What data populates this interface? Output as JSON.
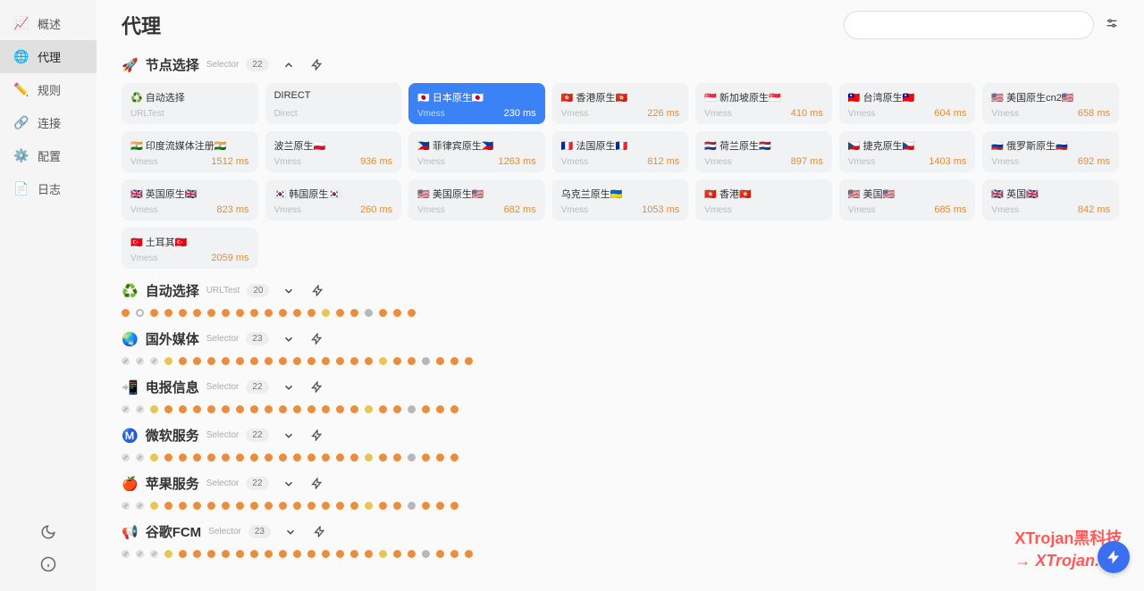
{
  "page_title": "代理",
  "sidebar": {
    "items": [
      {
        "icon": "📈",
        "label": "概述"
      },
      {
        "icon": "🌐",
        "label": "代理",
        "active": true
      },
      {
        "icon": "✏️",
        "label": "规则"
      },
      {
        "icon": "🔗",
        "label": "连接"
      },
      {
        "icon": "⚙️",
        "label": "配置"
      },
      {
        "icon": "📄",
        "label": "日志"
      }
    ]
  },
  "groups": [
    {
      "emoji": "🚀",
      "name": "节点选择",
      "type": "Selector",
      "count": "22",
      "expanded": true,
      "nodes": [
        {
          "title": "♻️ 自动选择",
          "proto": "URLTest",
          "latency": ""
        },
        {
          "title": "DIRECT",
          "proto": "Direct",
          "latency": ""
        },
        {
          "title": "🇯🇵 日本原生🇯🇵",
          "proto": "Vmess",
          "latency": "230 ms",
          "selected": true
        },
        {
          "title": "🇭🇰 香港原生🇭🇰",
          "proto": "Vmess",
          "latency": "226 ms"
        },
        {
          "title": "🇸🇬 新加坡原生🇸🇬",
          "proto": "Vmess",
          "latency": "410 ms"
        },
        {
          "title": "🇹🇼 台湾原生🇹🇼",
          "proto": "Vmess",
          "latency": "604 ms"
        },
        {
          "title": "🇺🇸 美国原生cn2🇺🇸",
          "proto": "Vmess",
          "latency": "658 ms"
        },
        {
          "title": "🇮🇳 印度流媒体注册🇮🇳",
          "proto": "Vmess",
          "latency": "1512 ms"
        },
        {
          "title": "波兰原生🇵🇱",
          "proto": "Vmess",
          "latency": "936 ms"
        },
        {
          "title": "🇵🇭 菲律宾原生🇵🇭",
          "proto": "Vmess",
          "latency": "1263 ms"
        },
        {
          "title": "🇫🇷 法国原生🇫🇷",
          "proto": "Vmess",
          "latency": "812 ms"
        },
        {
          "title": "🇳🇱 荷兰原生🇳🇱",
          "proto": "Vmess",
          "latency": "897 ms"
        },
        {
          "title": "🇨🇿 捷克原生🇨🇿",
          "proto": "Vmess",
          "latency": "1403 ms"
        },
        {
          "title": "🇷🇺 俄罗斯原生🇷🇺",
          "proto": "Vmess",
          "latency": "692 ms"
        },
        {
          "title": "🇬🇧 英国原生🇬🇧",
          "proto": "Vmess",
          "latency": "823 ms"
        },
        {
          "title": "🇰🇷 韩国原生🇰🇷",
          "proto": "Vmess",
          "latency": "260 ms"
        },
        {
          "title": "🇺🇸 美国原生🇺🇸",
          "proto": "Vmess",
          "latency": "682 ms"
        },
        {
          "title": "乌克兰原生🇺🇦",
          "proto": "Vmess",
          "latency": "1053 ms"
        },
        {
          "title": "🇭🇰 香港🇭🇰",
          "proto": "Vmess",
          "latency": ""
        },
        {
          "title": "🇺🇸 美国🇺🇸",
          "proto": "Vmess",
          "latency": "685 ms"
        },
        {
          "title": "🇬🇧 英国🇬🇧",
          "proto": "Vmess",
          "latency": "842 ms"
        },
        {
          "title": "🇹🇷 土耳其🇹🇷",
          "proto": "Vmess",
          "latency": "2059 ms"
        }
      ]
    },
    {
      "emoji": "♻️",
      "name": "自动选择",
      "type": "URLTest",
      "count": "20",
      "expanded": false,
      "dots": [
        "orange",
        "ring",
        "orange",
        "orange",
        "orange",
        "orange",
        "orange",
        "orange",
        "orange",
        "orange",
        "orange",
        "orange",
        "orange",
        "orange",
        "yellow",
        "orange",
        "orange",
        "grey",
        "orange",
        "orange",
        "orange"
      ]
    },
    {
      "emoji": "🌏",
      "name": "国外媒体",
      "type": "Selector",
      "count": "23",
      "expanded": false,
      "dots": [
        "no",
        "no",
        "no",
        "yellow",
        "orange",
        "orange",
        "orange",
        "orange",
        "orange",
        "orange",
        "orange",
        "orange",
        "orange",
        "orange",
        "orange",
        "orange",
        "orange",
        "orange",
        "yellow",
        "orange",
        "orange",
        "grey",
        "orange",
        "orange",
        "orange"
      ]
    },
    {
      "emoji": "📲",
      "name": "电报信息",
      "type": "Selector",
      "count": "22",
      "expanded": false,
      "dots": [
        "no",
        "no",
        "yellow",
        "orange",
        "orange",
        "orange",
        "orange",
        "orange",
        "orange",
        "orange",
        "orange",
        "orange",
        "orange",
        "orange",
        "orange",
        "orange",
        "orange",
        "yellow",
        "orange",
        "orange",
        "grey",
        "orange",
        "orange",
        "orange"
      ]
    },
    {
      "emoji": "Ⓜ️",
      "name": "微软服务",
      "type": "Selector",
      "count": "22",
      "expanded": false,
      "dots": [
        "no",
        "no",
        "yellow",
        "orange",
        "orange",
        "orange",
        "orange",
        "orange",
        "orange",
        "orange",
        "orange",
        "orange",
        "orange",
        "orange",
        "orange",
        "orange",
        "orange",
        "yellow",
        "orange",
        "orange",
        "grey",
        "orange",
        "orange",
        "orange"
      ]
    },
    {
      "emoji": "🍎",
      "name": "苹果服务",
      "type": "Selector",
      "count": "22",
      "expanded": false,
      "dots": [
        "no",
        "no",
        "yellow",
        "orange",
        "orange",
        "orange",
        "orange",
        "orange",
        "orange",
        "orange",
        "orange",
        "orange",
        "orange",
        "orange",
        "orange",
        "orange",
        "orange",
        "yellow",
        "orange",
        "orange",
        "grey",
        "orange",
        "orange",
        "orange"
      ]
    },
    {
      "emoji": "📢",
      "name": "谷歌FCM",
      "type": "Selector",
      "count": "23",
      "expanded": false,
      "dots": [
        "no",
        "no",
        "no",
        "yellow",
        "orange",
        "orange",
        "orange",
        "orange",
        "orange",
        "orange",
        "orange",
        "orange",
        "orange",
        "orange",
        "orange",
        "orange",
        "orange",
        "orange",
        "yellow",
        "orange",
        "orange",
        "grey",
        "orange",
        "orange",
        "orange"
      ]
    }
  ],
  "watermark": {
    "line1": "XTrojan黑科技",
    "line2": "→ XTrojan.CC"
  }
}
